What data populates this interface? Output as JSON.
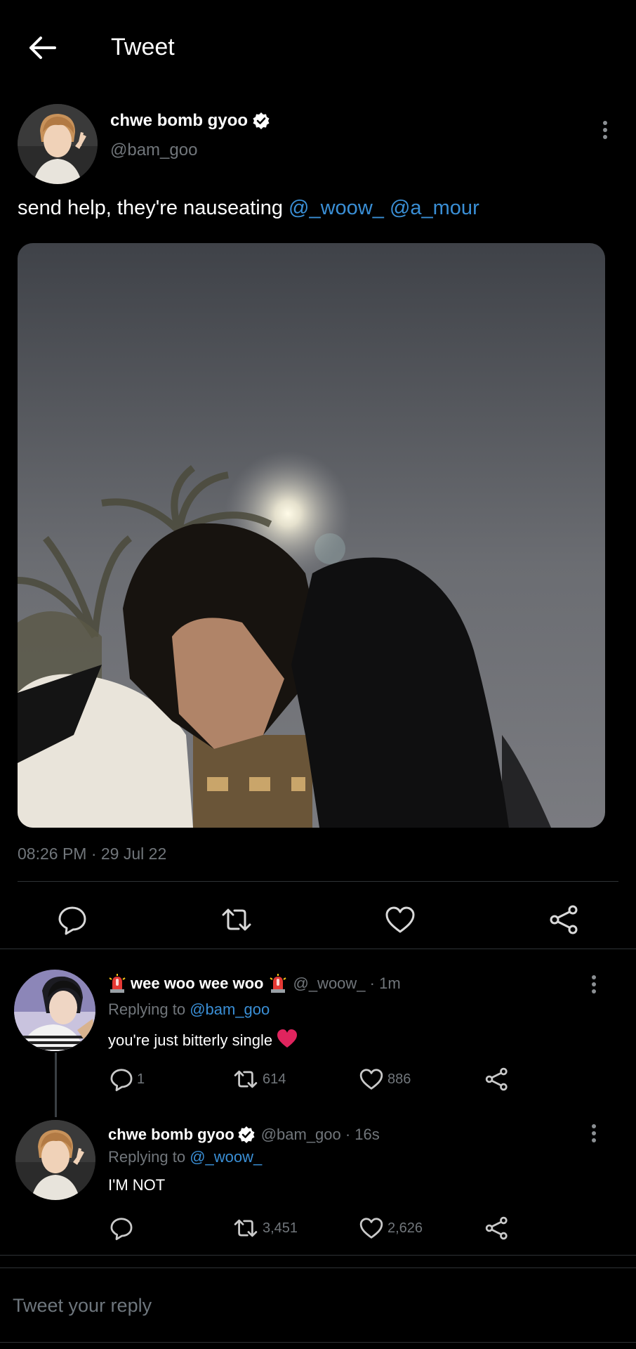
{
  "header": {
    "title": "Tweet"
  },
  "tweet": {
    "author_name": "chwe bomb gyoo",
    "author_handle": "@bam_goo",
    "text": "send help, they're nauseating ",
    "mentions": [
      "@_woow_",
      "@a_mour"
    ],
    "timestamp": "08:26 PM · 29 Jul 22"
  },
  "replies": [
    {
      "name": "wee woo wee woo",
      "meta": "@_woow_ · 1m",
      "replying_prefix": "Replying to ",
      "replying_to": "@bam_goo",
      "text": "you're just bitterly single",
      "reply_count": "1",
      "retweet_count": "614",
      "like_count": "886"
    },
    {
      "name": "chwe bomb gyoo",
      "meta": "@bam_goo · 16s",
      "replying_prefix": "Replying to ",
      "replying_to": "@_woow_",
      "text": "I'M NOT",
      "reply_count": "",
      "retweet_count": "3,451",
      "like_count": "2,626"
    }
  ],
  "composer": {
    "placeholder": "Tweet your reply"
  },
  "icons": {
    "back": "arrow-left-icon",
    "verified": "verified-badge-icon",
    "more": "more-vertical-icon",
    "reply": "reply-icon",
    "retweet": "retweet-icon",
    "like": "heart-icon",
    "share": "share-icon",
    "siren": "siren-emoji-icon",
    "heart_emoji": "red-heart-emoji-icon"
  },
  "colors": {
    "background": "#000000",
    "accent": "#3a8fd6",
    "muted": "#71767b"
  }
}
